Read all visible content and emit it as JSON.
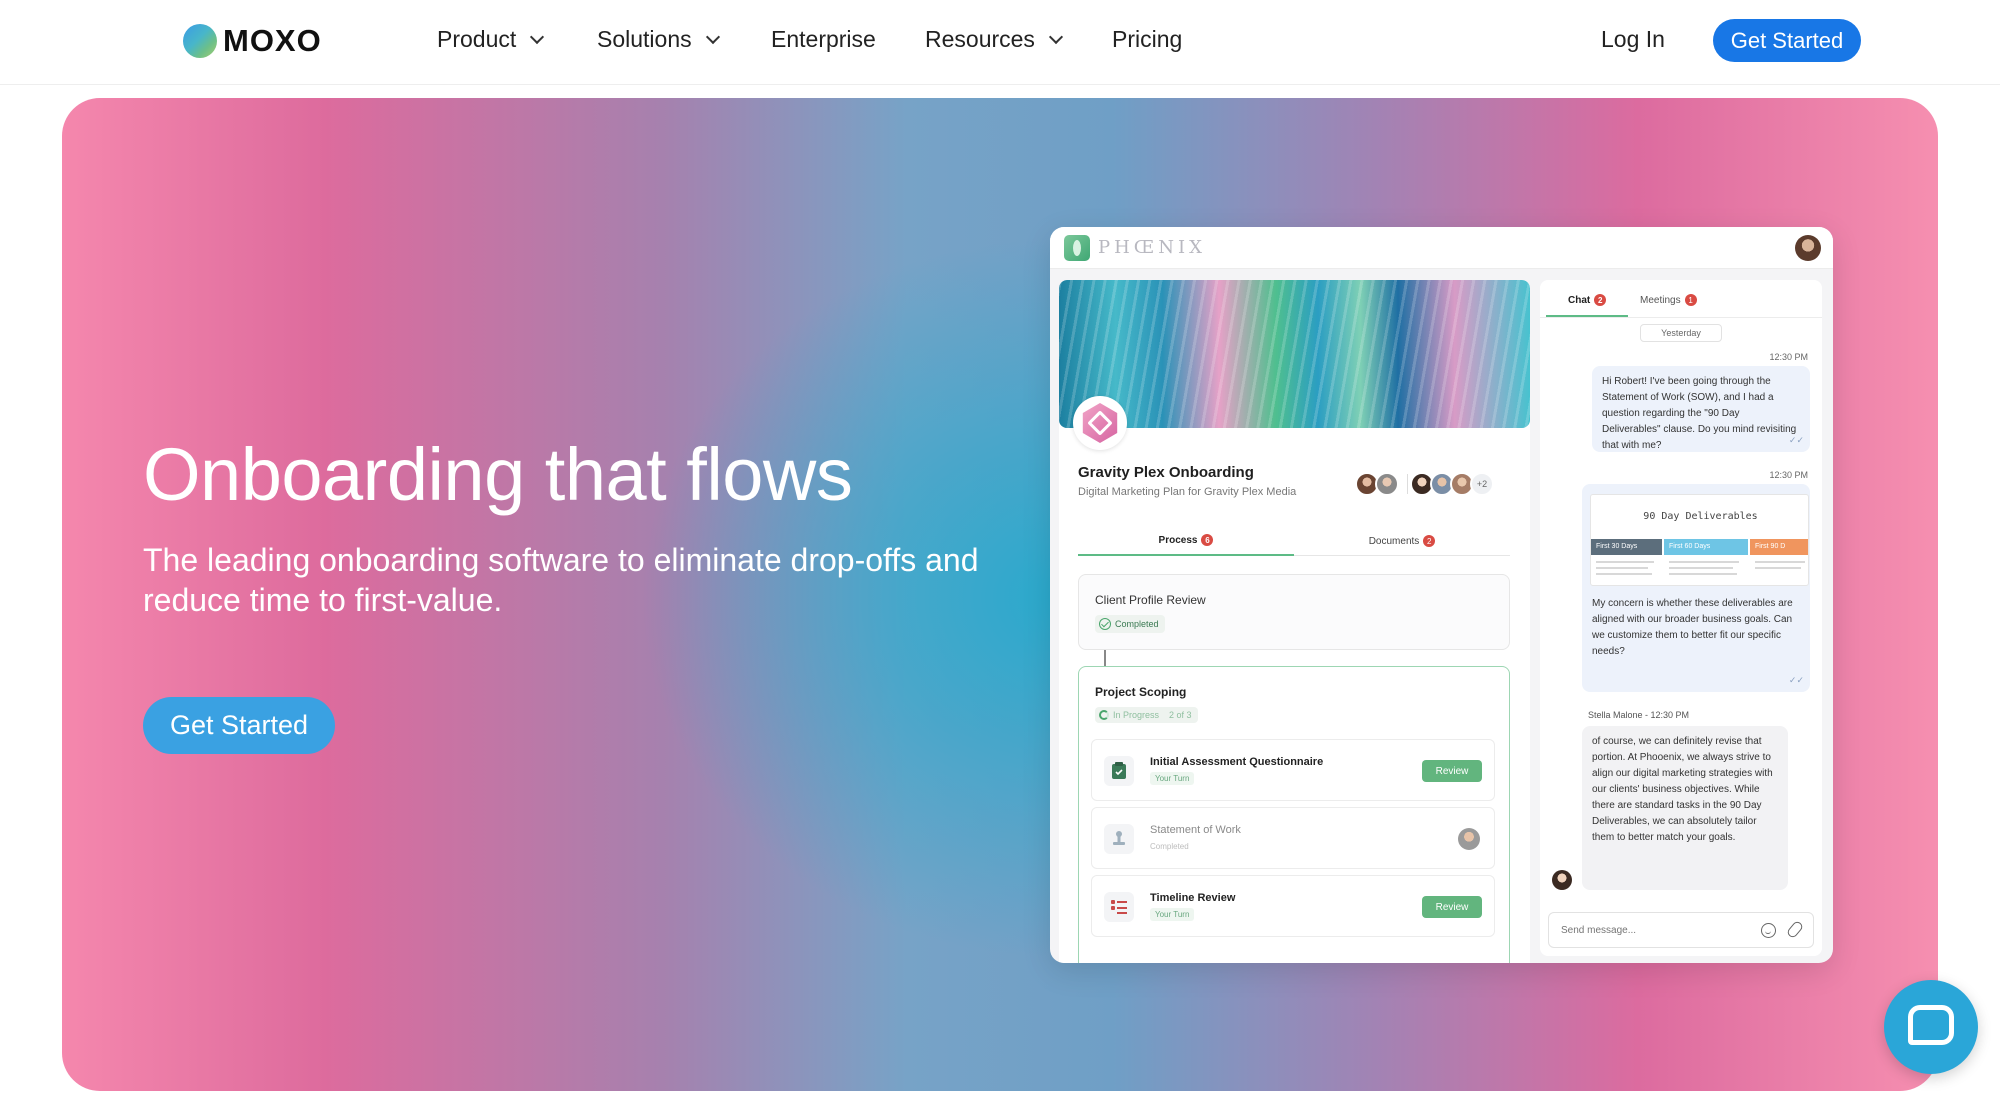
{
  "nav": {
    "logo_text": "MOXO",
    "items": [
      {
        "label": "Product",
        "dropdown": true
      },
      {
        "label": "Solutions",
        "dropdown": true
      },
      {
        "label": "Enterprise",
        "dropdown": false
      },
      {
        "label": "Resources",
        "dropdown": true
      },
      {
        "label": "Pricing",
        "dropdown": false
      }
    ],
    "login": "Log In",
    "cta": "Get Started"
  },
  "hero": {
    "title": "Onboarding that flows",
    "subtitle": "The leading onboarding software to eliminate drop-offs and reduce time to first-value.",
    "cta": "Get Started"
  },
  "app": {
    "brand": "PHŒNIX",
    "project": {
      "title": "Gravity Plex Onboarding",
      "subtitle": "Digital Marketing Plan for Gravity Plex Media",
      "more_members": "+2"
    },
    "tabs": [
      {
        "label": "Process",
        "badge": "6"
      },
      {
        "label": "Documents",
        "badge": "2"
      }
    ],
    "steps": {
      "client_profile": {
        "title": "Client Profile Review",
        "status": "Completed"
      },
      "project_scoping": {
        "title": "Project Scoping",
        "status": "In Progress",
        "progress": "2 of 3"
      }
    },
    "tasks": [
      {
        "name": "Initial Assessment Questionnaire",
        "status": "Your Turn",
        "action": "Review"
      },
      {
        "name": "Statement of Work",
        "status": "Completed",
        "action": ""
      },
      {
        "name": "Timeline Review",
        "status": "Your Turn",
        "action": "Review"
      }
    ],
    "chat": {
      "tabs": [
        {
          "label": "Chat",
          "badge": "2"
        },
        {
          "label": "Meetings",
          "badge": "1"
        }
      ],
      "day": "Yesterday",
      "time1": "12:30 PM",
      "msg1": "Hi Robert! I've been going through the Statement of Work (SOW), and I had a question regarding the \"90 Day Deliverables\" clause. Do you mind revisiting that with me?",
      "time2": "12:30 PM",
      "deliverables_title": "90 Day Deliverables",
      "deliverables_cols": [
        "First 30 Days",
        "First 60 Days",
        "First 90 D"
      ],
      "msg2": "My concern is whether these deliverables are aligned with our broader business goals. Can we customize them to better fit our specific needs?",
      "sender": "Stella Malone - 12:30 PM",
      "msg3": "of course, we can definitely revise that portion. At Phooenix, we always strive to align our digital marketing strategies with our clients' business objectives. While there are standard tasks in the 90 Day Deliverables, we can absolutely tailor them to better match your goals.",
      "placeholder": "Send message..."
    }
  },
  "colors": {
    "primary": "#1877e6",
    "hero_cta": "#3aa1e2",
    "accent_green": "#62b57e",
    "widget": "#2aa6d8"
  }
}
